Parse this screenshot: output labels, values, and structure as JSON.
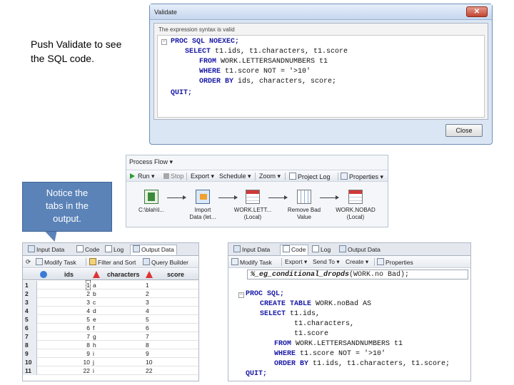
{
  "caption": {
    "line1": "Push Validate to see",
    "line2": "the SQL code."
  },
  "validate": {
    "title": "Validate",
    "close_x": "✕",
    "message": "The expression syntax is valid",
    "close_button": "Close",
    "code": {
      "l1_kw": "PROC SQL",
      "l1_rest": " NOEXEC;",
      "l2_kw": "SELECT",
      "l2_rest": " t1.ids, t1.characters, t1.score",
      "l3_kw": "FROM",
      "l3_rest": " WORK.LETTERSANDNUMBERS t1",
      "l4_kw": "WHERE",
      "l4_rest": " t1.score NOT = '>10'",
      "l5_kw": "ORDER BY",
      "l5_rest": " ids, characters, score;",
      "l6_kw": "QUIT;"
    }
  },
  "process_flow": {
    "title": "Process Flow ▾",
    "toolbar": {
      "run": "Run",
      "stop": "Stop",
      "export": "Export",
      "schedule": "Schedule",
      "zoom": "Zoom",
      "project_log": "Project Log",
      "properties": "Properties"
    },
    "nodes": [
      {
        "line1": "C:\\blah\\l...",
        "line2": ""
      },
      {
        "line1": "Import",
        "line2": "Data (let..."
      },
      {
        "line1": "WORK.LETT...",
        "line2": "(Local)"
      },
      {
        "line1": "Remove Bad",
        "line2": "Value"
      },
      {
        "line1": "WORK.NOBAD",
        "line2": "(Local)"
      }
    ]
  },
  "callout": {
    "line1": "Notice the",
    "line2": "tabs in the",
    "line3": "output."
  },
  "output_panel": {
    "tabs": [
      "Input Data",
      "Code",
      "Log",
      "Output Data"
    ],
    "toolbar": {
      "modify": "Modify Task",
      "filter": "Filter and Sort",
      "query": "Query Builder"
    },
    "columns": [
      "ids",
      "characters",
      "score"
    ],
    "rows": [
      {
        "n": "1",
        "ids": "1",
        "ch": "a",
        "sc": "1"
      },
      {
        "n": "2",
        "ids": "2",
        "ch": "b",
        "sc": "2"
      },
      {
        "n": "3",
        "ids": "3",
        "ch": "c",
        "sc": "3"
      },
      {
        "n": "4",
        "ids": "4",
        "ch": "d",
        "sc": "4"
      },
      {
        "n": "5",
        "ids": "5",
        "ch": "e",
        "sc": "5"
      },
      {
        "n": "6",
        "ids": "6",
        "ch": "f",
        "sc": "6"
      },
      {
        "n": "7",
        "ids": "7",
        "ch": "g",
        "sc": "7"
      },
      {
        "n": "8",
        "ids": "8",
        "ch": "h",
        "sc": "8"
      },
      {
        "n": "9",
        "ids": "9",
        "ch": "i",
        "sc": "9"
      },
      {
        "n": "10",
        "ids": "10",
        "ch": "j",
        "sc": "10"
      },
      {
        "n": "11",
        "ids": "22",
        "ch": "i",
        "sc": "22"
      }
    ]
  },
  "code_panel": {
    "tabs": [
      "Input Data",
      "Code",
      "Log",
      "Output Data"
    ],
    "toolbar": {
      "modify": "Modify Task",
      "export": "Export",
      "send": "Send To",
      "create": "Create",
      "properties": "Properties"
    },
    "subject_prefix": "%_eg_conditional_dropds",
    "subject_arg": "(WORK.no Bad);",
    "code": {
      "l1_kw": "PROC SQL;",
      "l2_kw": "CREATE TABLE",
      "l2_rest": " WORK.noBad AS",
      "l3_kw": "SELECT",
      "l3_rest": " t1.ids,",
      "l4_rest": "t1.characters,",
      "l5_rest": "t1.score",
      "l6_kw": "FROM",
      "l6_rest": " WORK.LETTERSANDNUMBERS t1",
      "l7_kw": "WHERE",
      "l7_rest": " t1.score NOT = '>10'",
      "l8_kw": "ORDER BY",
      "l8_rest": " t1.ids, t1.characters, t1.score;",
      "l9_kw": "QUIT;"
    }
  },
  "colors": {
    "accent": "#5b83b8",
    "keyword": "#1a1aa6",
    "window_border": "#6d8fb8"
  }
}
